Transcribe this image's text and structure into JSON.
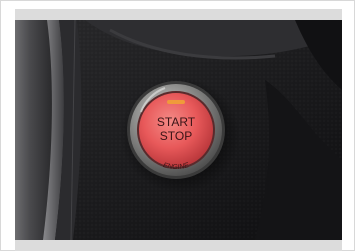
{
  "photo": {
    "subject": "engine start-stop push button",
    "button_label_line1": "START",
    "button_label_line2": "STOP",
    "button_label_curved": "ENGINE",
    "colors": {
      "button_face": "#e8595a",
      "button_face_highlight": "#f48a86",
      "indicator": "#f09a3a",
      "chrome_ring": "#9a9a98",
      "dashboard": "#222224",
      "trim_left": "#3c3c3e"
    }
  }
}
